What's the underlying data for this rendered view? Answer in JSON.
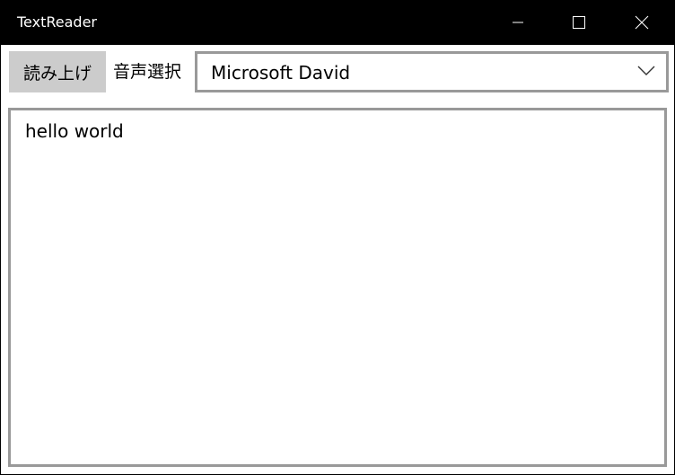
{
  "window": {
    "title": "TextReader",
    "minimize_icon": "minimize-icon",
    "maximize_icon": "maximize-icon",
    "close_icon": "close-icon"
  },
  "toolbar": {
    "read_button_label": "読み上げ",
    "voice_label": "音声選択",
    "voice_selected": "Microsoft David",
    "dropdown_icon": "chevron-down-icon"
  },
  "editor": {
    "text": "hello world"
  },
  "colors": {
    "titlebar": "#000000",
    "button_bg": "#cccccc",
    "border": "#999999"
  }
}
